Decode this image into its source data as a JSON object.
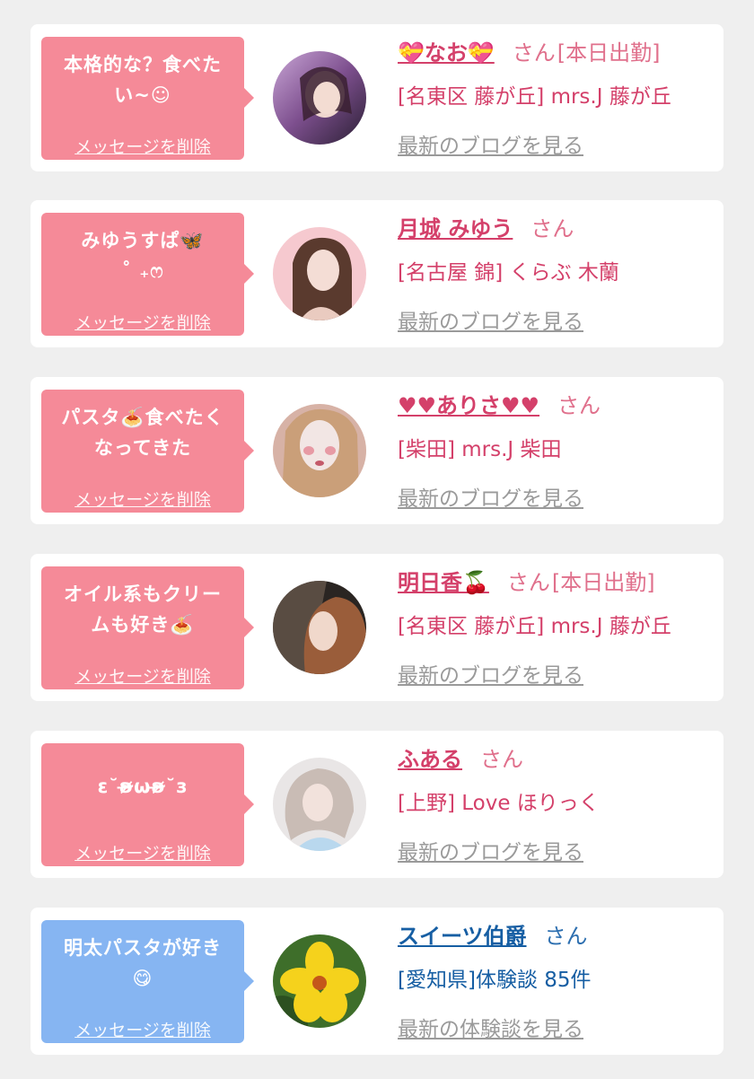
{
  "delete_label": "メッセージを削除",
  "colors": {
    "pink_bubble": "#f58a98",
    "blue_bubble": "#86b5f2",
    "pink_text": "#d4406a",
    "blue_text": "#165ea3",
    "blog_link": "#9a9a9a",
    "background": "#efefef"
  },
  "cards": [
    {
      "message": "本格的な？食べた\nい~☺",
      "name": "💝なお💝",
      "suffix": "さん",
      "tag": "[本日出勤]",
      "location": "[名東区 藤が丘] mrs.J 藤が丘",
      "link": "最新のブログを見る",
      "avatar": "avatar-photo"
    },
    {
      "message": "みゆうすぱ🦋\n˚ ₊ෆ",
      "name": "月城 みゆう",
      "suffix": "さん",
      "tag": "",
      "location": "[名古屋 錦] くらぶ 木蘭",
      "link": "最新のブログを見る",
      "avatar": "avatar-photo"
    },
    {
      "message": "パスタ🍝食べたく\nなってきた",
      "name": "♥♥ありさ♥♥",
      "suffix": "さん",
      "tag": "",
      "location": "[柴田] mrs.J 柴田",
      "link": "最新のブログを見る",
      "avatar": "avatar-photo"
    },
    {
      "message": "オイル系もクリー\nムも好き🍝",
      "name": "明日香🍒",
      "suffix": "さん",
      "tag": "[本日出勤]",
      "location": "[名東区 藤が丘] mrs.J 藤が丘",
      "link": "最新のブログを見る",
      "avatar": "avatar-photo"
    },
    {
      "message": "ε˘ʚ̴̶̷̷ωʚ̴̶̷̷˘з",
      "name": "ふある",
      "suffix": "さん",
      "tag": "",
      "location": "[上野] Love ほりっく",
      "link": "最新のブログを見る",
      "avatar": "avatar-photo"
    },
    {
      "message": "明太パスタが好き\n😋",
      "name": "スイーツ伯爵",
      "suffix": "さん",
      "tag": "",
      "location": "[愛知県]体験談 85件",
      "link": "最新の体験談を見る",
      "avatar": "avatar-flower"
    }
  ]
}
